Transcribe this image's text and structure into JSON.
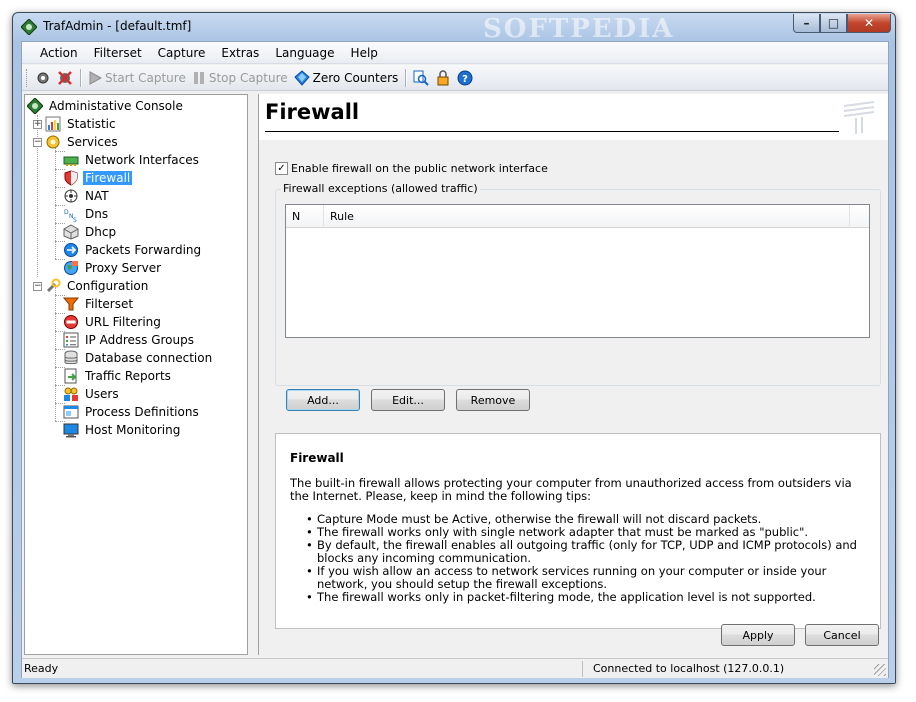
{
  "window": {
    "title": "TrafAdmin - [default.tmf]",
    "watermark": "SOFTPEDIA",
    "controls": {
      "minimize": "–",
      "maximize": "□",
      "close": "✕"
    }
  },
  "menu": [
    "Action",
    "Filterset",
    "Capture",
    "Extras",
    "Language",
    "Help"
  ],
  "toolbar": {
    "start_capture": "Start Capture",
    "stop_capture": "Stop Capture",
    "zero_counters": "Zero Counters"
  },
  "tree": {
    "root": "Administative Console",
    "statistic": "Statistic",
    "services": "Services",
    "service_items": [
      "Network Interfaces",
      "Firewall",
      "NAT",
      "Dns",
      "Dhcp",
      "Packets Forwarding",
      "Proxy Server"
    ],
    "configuration": "Configuration",
    "config_items": [
      "Filterset",
      "URL Filtering",
      "IP Address Groups",
      "Database connection",
      "Traffic Reports",
      "Users",
      "Process Definitions",
      "Host Monitoring"
    ],
    "selected": "Firewall"
  },
  "panel": {
    "title": "Firewall",
    "enable_checkbox": "Enable firewall on the public network interface",
    "enable_checked": true,
    "exceptions_group": "Firewall exceptions (allowed traffic)",
    "columns": [
      "N",
      "Rule"
    ],
    "buttons": {
      "add": "Add...",
      "edit": "Edit...",
      "remove": "Remove"
    }
  },
  "info": {
    "title": "Firewall",
    "intro": "The built-in firewall allows protecting your computer from unauthorized access from outsiders via the Internet. Please, keep in mind the following tips:",
    "tips": [
      "Capture Mode must be Active, otherwise the firewall will not discard packets.",
      "The firewall works only with single network adapter that must be marked as \"public\".",
      "By default, the firewall enables all outgoing traffic (only for TCP, UDP and ICMP protocols) and blocks any incoming communication.",
      "If you wish allow an access to network services running on your computer or inside your network, you should setup the firewall exceptions.",
      "The firewall works only in packet-filtering mode, the application level is not supported."
    ]
  },
  "footer": {
    "apply": "Apply",
    "cancel": "Cancel"
  },
  "status": {
    "left": "Ready",
    "right": "Connected to localhost (127.0.0.1)"
  },
  "colors": {
    "selection": "#3399ff",
    "title_bar": "#a9c3e4",
    "close_button": "#c2452d"
  }
}
